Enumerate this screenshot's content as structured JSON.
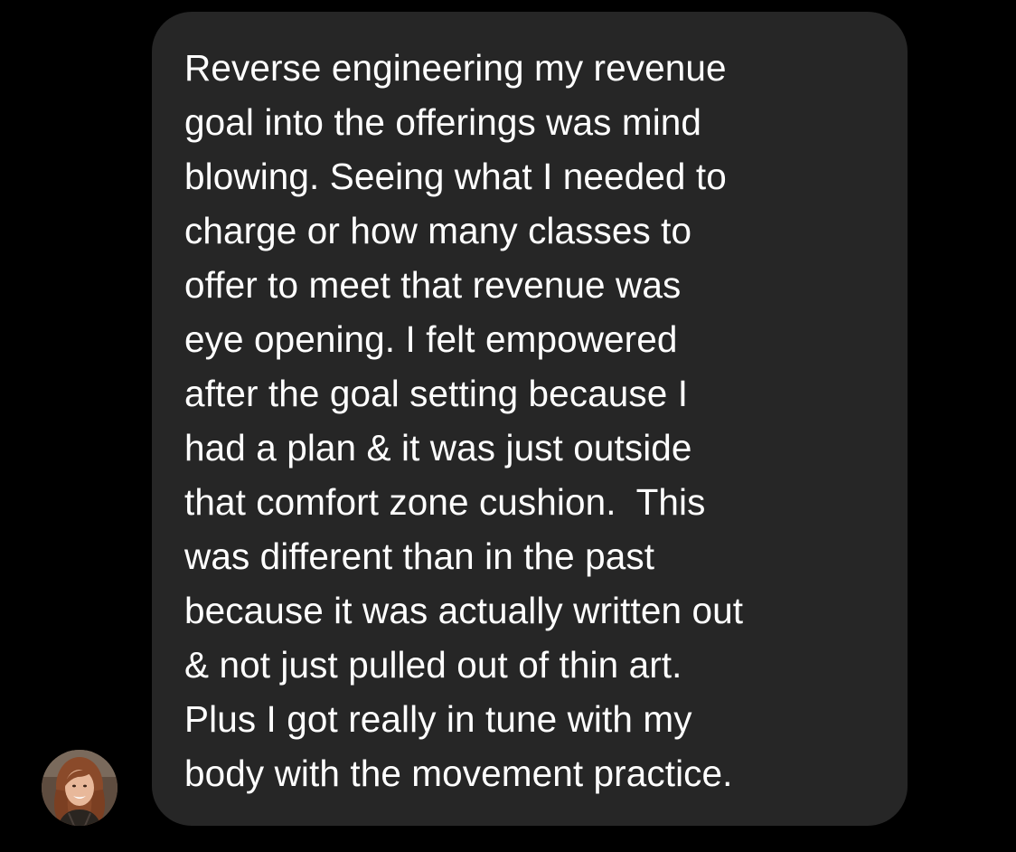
{
  "conversation": {
    "message": {
      "sender_avatar": {
        "icon": "profile-photo-woman"
      },
      "lines": [
        "Reverse engineering my revenue",
        "goal into the offerings was mind",
        "blowing. Seeing what I needed to",
        "charge or how many classes to",
        "offer to meet that revenue was",
        "eye opening. I felt empowered",
        "after the goal setting because I",
        "had a plan & it was just outside",
        "that comfort zone cushion.  This",
        "was different than in the past",
        "because it was actually written out",
        "& not just pulled out of thin art.",
        "Plus I got really in tune with my",
        "body with the movement practice."
      ]
    }
  },
  "colors": {
    "background": "#000000",
    "bubble": "#262626",
    "text": "#ffffff"
  }
}
